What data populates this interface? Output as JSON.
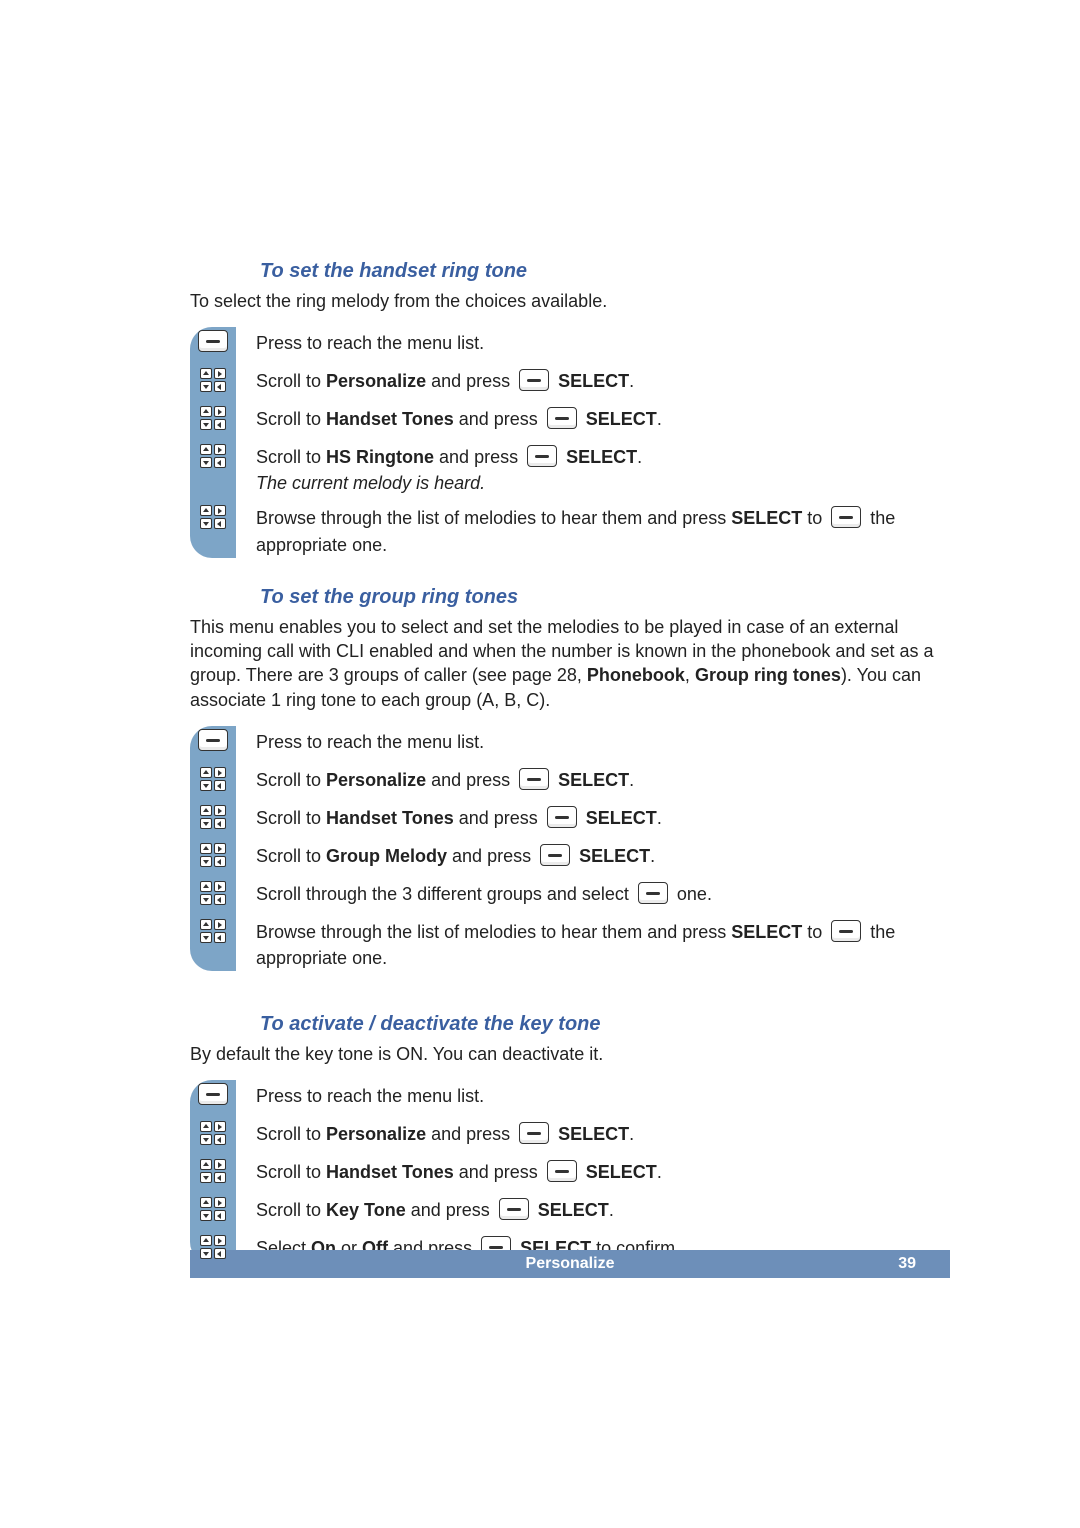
{
  "section1": {
    "heading": "To set the handset ring tone",
    "intro": "To select the ring melody from the choices available.",
    "steps": [
      {
        "icon": "menu",
        "text_plain": "Press to reach the menu list."
      },
      {
        "icon": "nav",
        "pre": "Scroll to ",
        "bold1": "Personalize",
        "mid": " and press ",
        "btn": true,
        "bold2": "SELECT",
        "post": "."
      },
      {
        "icon": "nav",
        "pre": "Scroll to ",
        "bold1": "Handset Tones",
        "mid": " and press ",
        "btn": true,
        "bold2": "SELECT",
        "post": "."
      },
      {
        "icon": "nav",
        "pre": "Scroll to ",
        "bold1": "HS Ringtone",
        "mid": " and press ",
        "btn": true,
        "bold2": "SELECT",
        "post": ".",
        "italic_after": "The current melody is heard."
      },
      {
        "icon": "nav",
        "pre": "Browse through the list of melodies to hear them and press ",
        "btn": true,
        "mid": " to ",
        "bold1": "SELECT",
        "post": " the appropriate one."
      }
    ]
  },
  "section2": {
    "heading": "To set the group ring tones",
    "intro_parts": {
      "p1": "This menu enables you to select and set the melodies to be played in case of an external incoming call with CLI enabled and when the number is known in the phonebook and set as a group. There are 3 groups of caller (see page 28, ",
      "b1": "Phonebook",
      "sep": ", ",
      "b2": "Group ring tones",
      "p2": "). You can associate 1 ring tone to each group (A, B, C)."
    },
    "steps": [
      {
        "icon": "menu",
        "text_plain": "Press to reach the menu list."
      },
      {
        "icon": "nav",
        "pre": "Scroll to ",
        "bold1": "Personalize",
        "mid": " and press ",
        "btn": true,
        "bold2": "SELECT",
        "post": "."
      },
      {
        "icon": "nav",
        "pre": "Scroll to ",
        "bold1": "Handset Tones",
        "mid": " and press ",
        "btn": true,
        "bold2": "SELECT",
        "post": "."
      },
      {
        "icon": "nav",
        "pre": "Scroll to ",
        "bold1": "Group Melody",
        "mid": " and press ",
        "btn": true,
        "bold2": "SELECT",
        "post": "."
      },
      {
        "icon": "nav",
        "pre": "Scroll through the 3 different groups and select ",
        "btn": true,
        "post": " one."
      },
      {
        "icon": "nav",
        "pre": "Browse through the list of melodies to hear them and press ",
        "btn": true,
        "mid": " to ",
        "bold1": "SELECT",
        "post": " the appropriate one."
      }
    ]
  },
  "section3": {
    "heading": "To activate / deactivate the key tone",
    "intro": "By default the key tone is ON. You can deactivate it.",
    "steps": [
      {
        "icon": "menu",
        "text_plain": "Press to reach the menu list."
      },
      {
        "icon": "nav",
        "pre": "Scroll to ",
        "bold1": "Personalize",
        "mid": " and press ",
        "btn": true,
        "bold2": "SELECT",
        "post": "."
      },
      {
        "icon": "nav",
        "pre": "Scroll to ",
        "bold1": "Handset Tones",
        "mid": " and press ",
        "btn": true,
        "bold2": "SELECT",
        "post": "."
      },
      {
        "icon": "nav",
        "pre": "Scroll to ",
        "bold1": "Key Tone",
        "mid": " and press ",
        "btn": true,
        "bold2": "SELECT",
        "post": "."
      },
      {
        "icon": "nav",
        "pre": "Select ",
        "bold1": "On",
        "mid1": " or ",
        "bold2": "Off",
        "mid2": " and press ",
        "btn": true,
        "bold3": "SELECT",
        "post": " to confirm."
      }
    ]
  },
  "footer": {
    "label": "Personalize",
    "page": "39"
  }
}
